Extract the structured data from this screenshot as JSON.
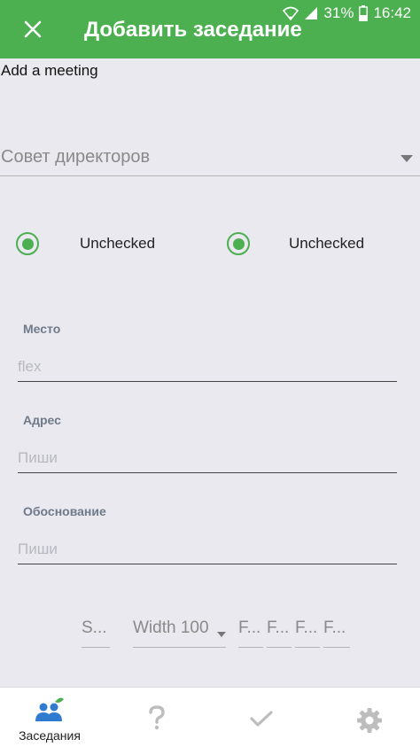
{
  "status_bar": {
    "battery": "31%",
    "time": "16:42"
  },
  "header": {
    "title": "Добавить заседание"
  },
  "subtitle": "Add a meeting",
  "committee_select": {
    "value": "Совет директоров"
  },
  "radios": [
    {
      "label": "Unchecked",
      "selected": true
    },
    {
      "label": "Unchecked",
      "selected": true
    }
  ],
  "fields": {
    "place": {
      "label": "Место",
      "placeholder": "flex"
    },
    "address": {
      "label": "Адрес",
      "placeholder": "Пиши"
    },
    "reason": {
      "label": "Обоснование",
      "placeholder": "Пиши"
    }
  },
  "selects": {
    "s": "S...",
    "width": "Width 100",
    "f1": "F...",
    "f2": "F...",
    "f3": "F...",
    "f4": "F..."
  },
  "bottom_nav": {
    "meetings": {
      "label": "Заседания",
      "icon": "people-icon"
    },
    "help": {
      "icon": "question-icon"
    },
    "confirm": {
      "icon": "check-icon"
    },
    "settings": {
      "icon": "gear-icon"
    }
  },
  "colors": {
    "accent": "#4caf50",
    "background": "#e9e9ef",
    "meetings_icon": "#2e7bcf"
  }
}
